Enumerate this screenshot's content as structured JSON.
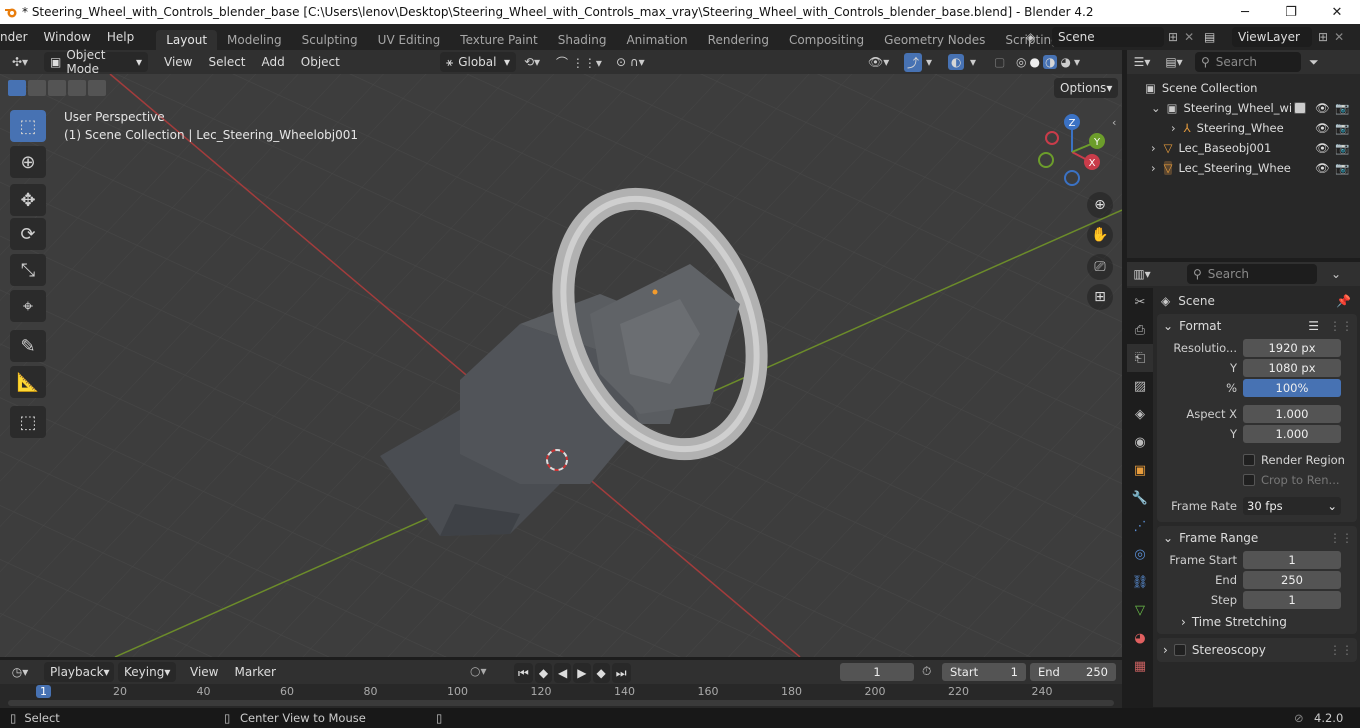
{
  "title_bar": {
    "title": "* Steering_Wheel_with_Controls_blender_base [C:\\Users\\lenov\\Desktop\\Steering_Wheel_with_Controls_max_vray\\Steering_Wheel_with_Controls_blender_base.blend] - Blender 4.2",
    "minimize": "─",
    "maximize": "❐",
    "close": "✕"
  },
  "menus": [
    "nder",
    "Window",
    "Help"
  ],
  "workspaces": [
    "Layout",
    "Modeling",
    "Sculpting",
    "UV Editing",
    "Texture Paint",
    "Shading",
    "Animation",
    "Rendering",
    "Compositing",
    "Geometry Nodes",
    "Scripting"
  ],
  "add_workspace": "+",
  "scene_name": "Scene",
  "view_layer": "ViewLayer",
  "viewport_header": {
    "mode": "Object Mode",
    "menus": [
      "View",
      "Select",
      "Add",
      "Object"
    ],
    "orientation": "Global",
    "options": "Options"
  },
  "viewport": {
    "perspective": "User Perspective",
    "collection_info": "(1) Scene Collection | Lec_Steering_Wheelobj001",
    "axes": {
      "x": "X",
      "y": "Y",
      "z": "Z"
    }
  },
  "outliner": {
    "search_placeholder": "Search",
    "root": "Scene Collection",
    "items": [
      "Steering_Wheel_wi",
      "Steering_Whee",
      "Lec_Baseobj001",
      "Lec_Steering_Whee"
    ]
  },
  "properties": {
    "search_placeholder": "Search",
    "context": "Scene",
    "format": {
      "title": "Format",
      "resolution_label": "Resolutio...",
      "res_x": "1920 px",
      "y_label": "Y",
      "res_y": "1080 px",
      "pct_label": "%",
      "pct": "100%",
      "aspect_label": "Aspect X",
      "aspect_x": "1.000",
      "aspect_y": "1.000",
      "render_region": "Render Region",
      "crop": "Crop to Ren...",
      "frame_rate_label": "Frame Rate",
      "frame_rate": "30 fps"
    },
    "frame_range": {
      "title": "Frame Range",
      "start_label": "Frame Start",
      "start": "1",
      "end_label": "End",
      "end": "250",
      "step_label": "Step",
      "step": "1"
    },
    "time_stretching": "Time Stretching",
    "stereoscopy": "Stereoscopy"
  },
  "timeline": {
    "menus": [
      "Playback",
      "Keying",
      "View",
      "Marker"
    ],
    "current_frame": "1",
    "start_label": "Start",
    "start": "1",
    "end_label": "End",
    "end": "250",
    "ticks": [
      "1",
      "20",
      "40",
      "60",
      "80",
      "100",
      "120",
      "140",
      "160",
      "180",
      "200",
      "220",
      "240"
    ]
  },
  "status_bar": {
    "select": "Select",
    "center_view": "Center View to Mouse",
    "version": "4.2.0"
  }
}
